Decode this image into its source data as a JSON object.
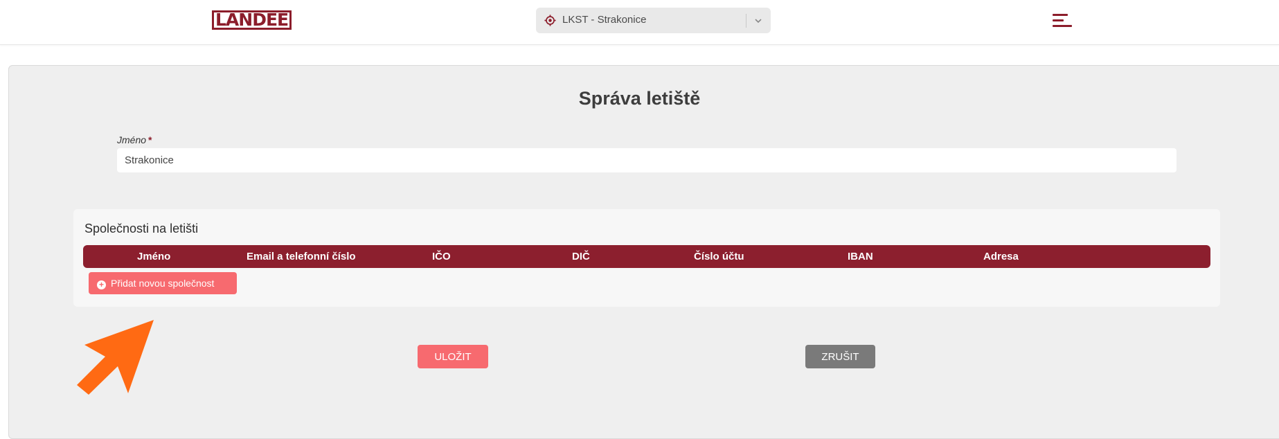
{
  "header": {
    "logo_text": "LANDEE",
    "airport_selector_value": "LKST - Strakonice",
    "colors": {
      "brand": "#8c1d2b",
      "selector_bg": "#e9e9e9"
    }
  },
  "page": {
    "title": "Správa letiště"
  },
  "form": {
    "name_label": "Jméno",
    "name_required_mark": "*",
    "name_value": "Strakonice"
  },
  "companies": {
    "title": "Společnosti na letišti",
    "columns": [
      "Jméno",
      "Email a telefonní číslo",
      "IČO",
      "DIČ",
      "Číslo účtu",
      "IBAN",
      "Adresa"
    ],
    "rows": [],
    "add_button_label": "Přidat novou společnost"
  },
  "actions": {
    "save_label": "ULOŽIT",
    "cancel_label": "ZRUŠIT",
    "colors": {
      "primary": "#f76a6f",
      "secondary": "#7a7a7a",
      "table_header": "#8c1f2e"
    }
  },
  "annotation": {
    "icon": "arrow-icon",
    "color": "#ff6a13"
  }
}
